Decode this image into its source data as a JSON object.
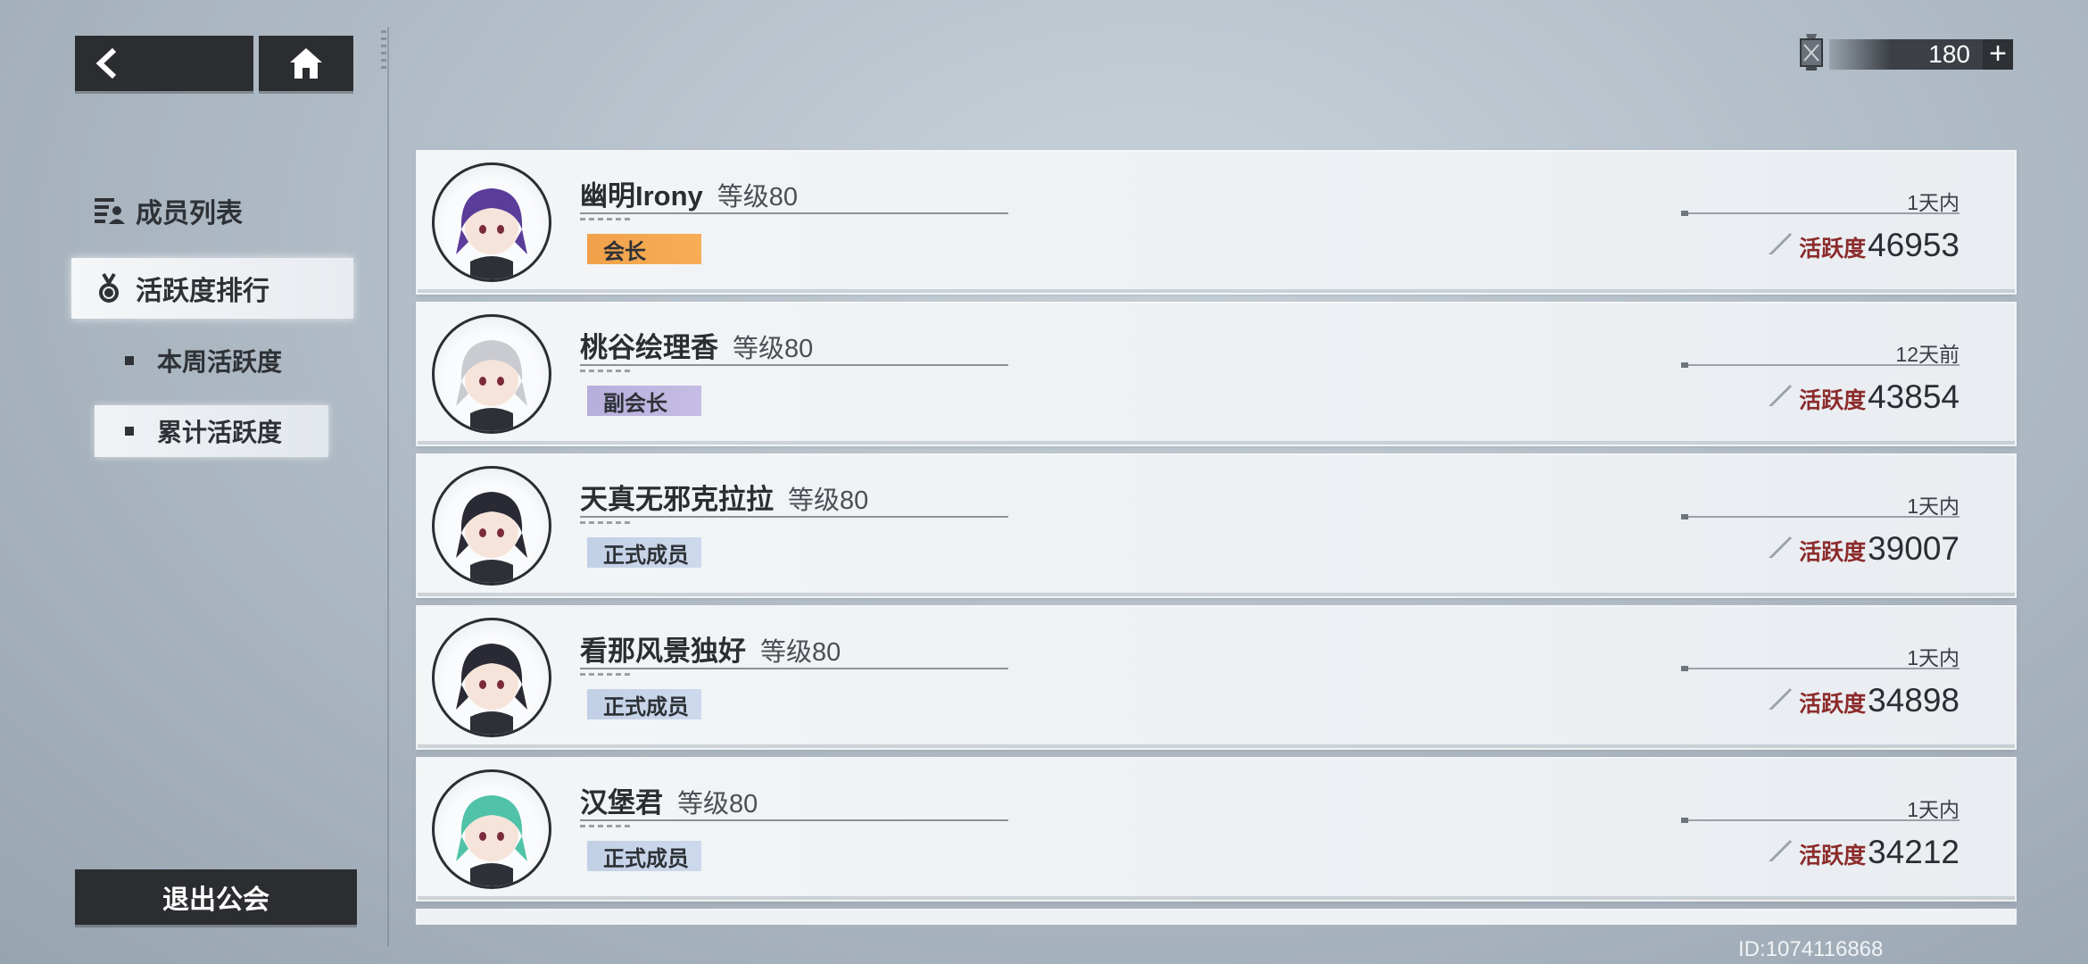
{
  "topbar": {
    "back_icon": "chevron-left-icon",
    "home_icon": "home-icon",
    "currency": {
      "icon": "lantern-icon",
      "value": "180",
      "add_label": "+"
    }
  },
  "sidebar": {
    "members_label": "成员列表",
    "activity_label": "活跃度排行",
    "weekly_label": "本周活跃度",
    "total_label": "累计活跃度",
    "exit_label": "退出公会"
  },
  "members": [
    {
      "name": "幽明Irony",
      "level": "等级80",
      "role": "会长",
      "role_type": "leader",
      "last_online": "1天内",
      "activity_label": "活跃度",
      "activity": "46953",
      "avatar_hair": "#5a3d9a"
    },
    {
      "name": "桃谷绘理香",
      "level": "等级80",
      "role": "副会长",
      "role_type": "vice",
      "last_online": "12天前",
      "activity_label": "活跃度",
      "activity": "43854",
      "avatar_hair": "#c9cbd0"
    },
    {
      "name": "天真无邪克拉拉",
      "level": "等级80",
      "role": "正式成员",
      "role_type": "member",
      "last_online": "1天内",
      "activity_label": "活跃度",
      "activity": "39007",
      "avatar_hair": "#2a2a35"
    },
    {
      "name": "看那风景独好",
      "level": "等级80",
      "role": "正式成员",
      "role_type": "member",
      "last_online": "1天内",
      "activity_label": "活跃度",
      "activity": "34898",
      "avatar_hair": "#2a2a35"
    },
    {
      "name": "汉堡君",
      "level": "等级80",
      "role": "正式成员",
      "role_type": "member",
      "last_online": "1天内",
      "activity_label": "活跃度",
      "activity": "34212",
      "avatar_hair": "#4fc2a8"
    }
  ],
  "footer": {
    "player_id": "ID:1074116868"
  },
  "colors": {
    "leader": "#f7ad56",
    "vice": "#c6bde6",
    "member": "#cdd9ec",
    "activity_label": "#8c2b2b"
  }
}
